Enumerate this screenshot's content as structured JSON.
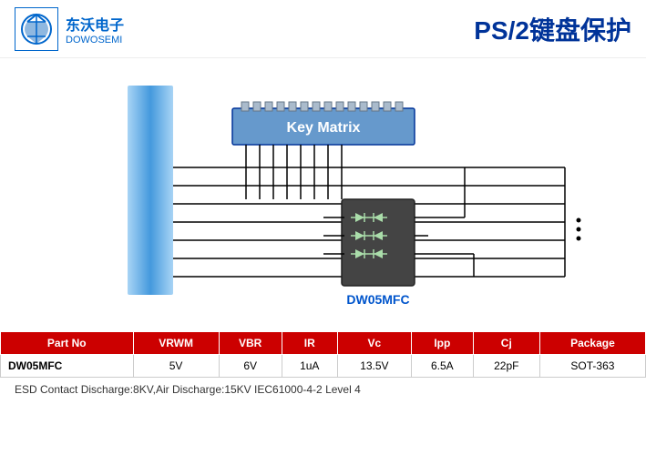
{
  "header": {
    "logo_chinese": "东沃电子",
    "logo_english": "DOWOSEMI",
    "title": "PS/2键盘保护"
  },
  "diagram": {
    "key_matrix_label": "Key Matrix",
    "component_label": "DW05MFC",
    "dots": "..."
  },
  "table": {
    "headers": [
      "Part No",
      "VRWM",
      "VBR",
      "IR",
      "Vc",
      "Ipp",
      "Cj",
      "Package"
    ],
    "rows": [
      [
        "DW05MFC",
        "5V",
        "6V",
        "1uA",
        "13.5V",
        "6.5A",
        "22pF",
        "SOT-363"
      ]
    ]
  },
  "footer": {
    "text": "ESD Contact Discharge:8KV,Air Discharge:15KV  IEC61000-4-2 Level 4"
  }
}
